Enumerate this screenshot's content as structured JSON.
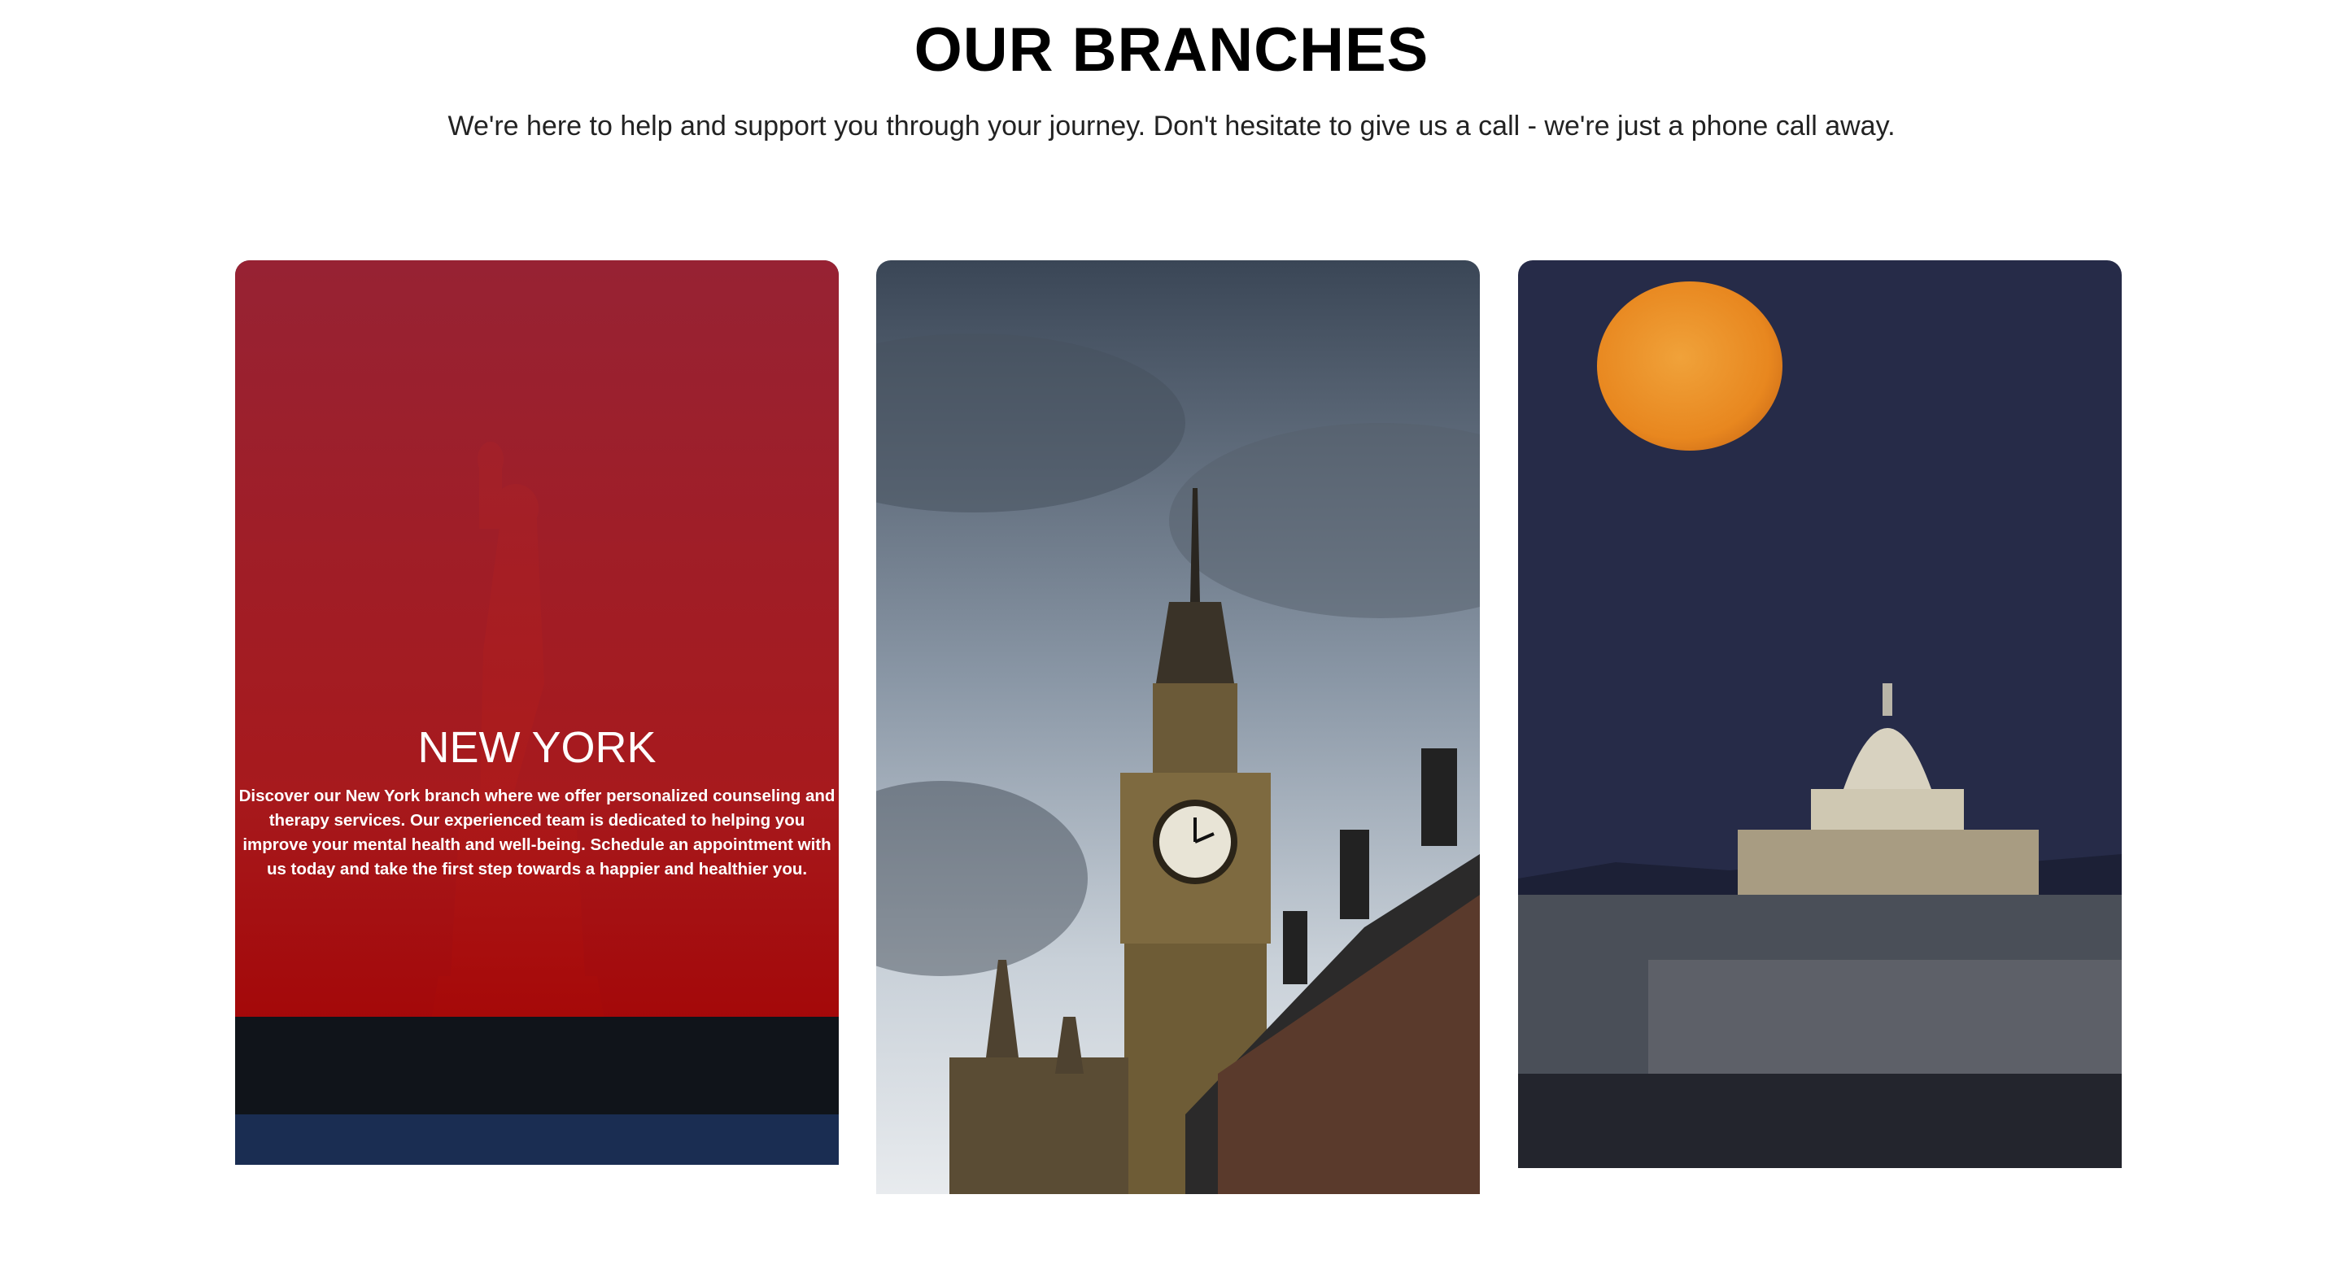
{
  "section": {
    "title": "OUR BRANCHES",
    "subtitle": "We're here to help and support you through your journey. Don't hesitate to give us a call - we're just a phone call away."
  },
  "branches": [
    {
      "name": "NEW YORK",
      "description": "Discover our New York branch where we offer personalized counseling and therapy services. Our experienced team is dedicated to helping you improve your mental health and well-being. Schedule an appointment with us today and take the first step towards a happier and healthier you.",
      "image": "statue-of-liberty",
      "overlay_color": "#b22234"
    },
    {
      "image": "big-ben-london"
    },
    {
      "image": "us-capitol-full-moon"
    }
  ]
}
